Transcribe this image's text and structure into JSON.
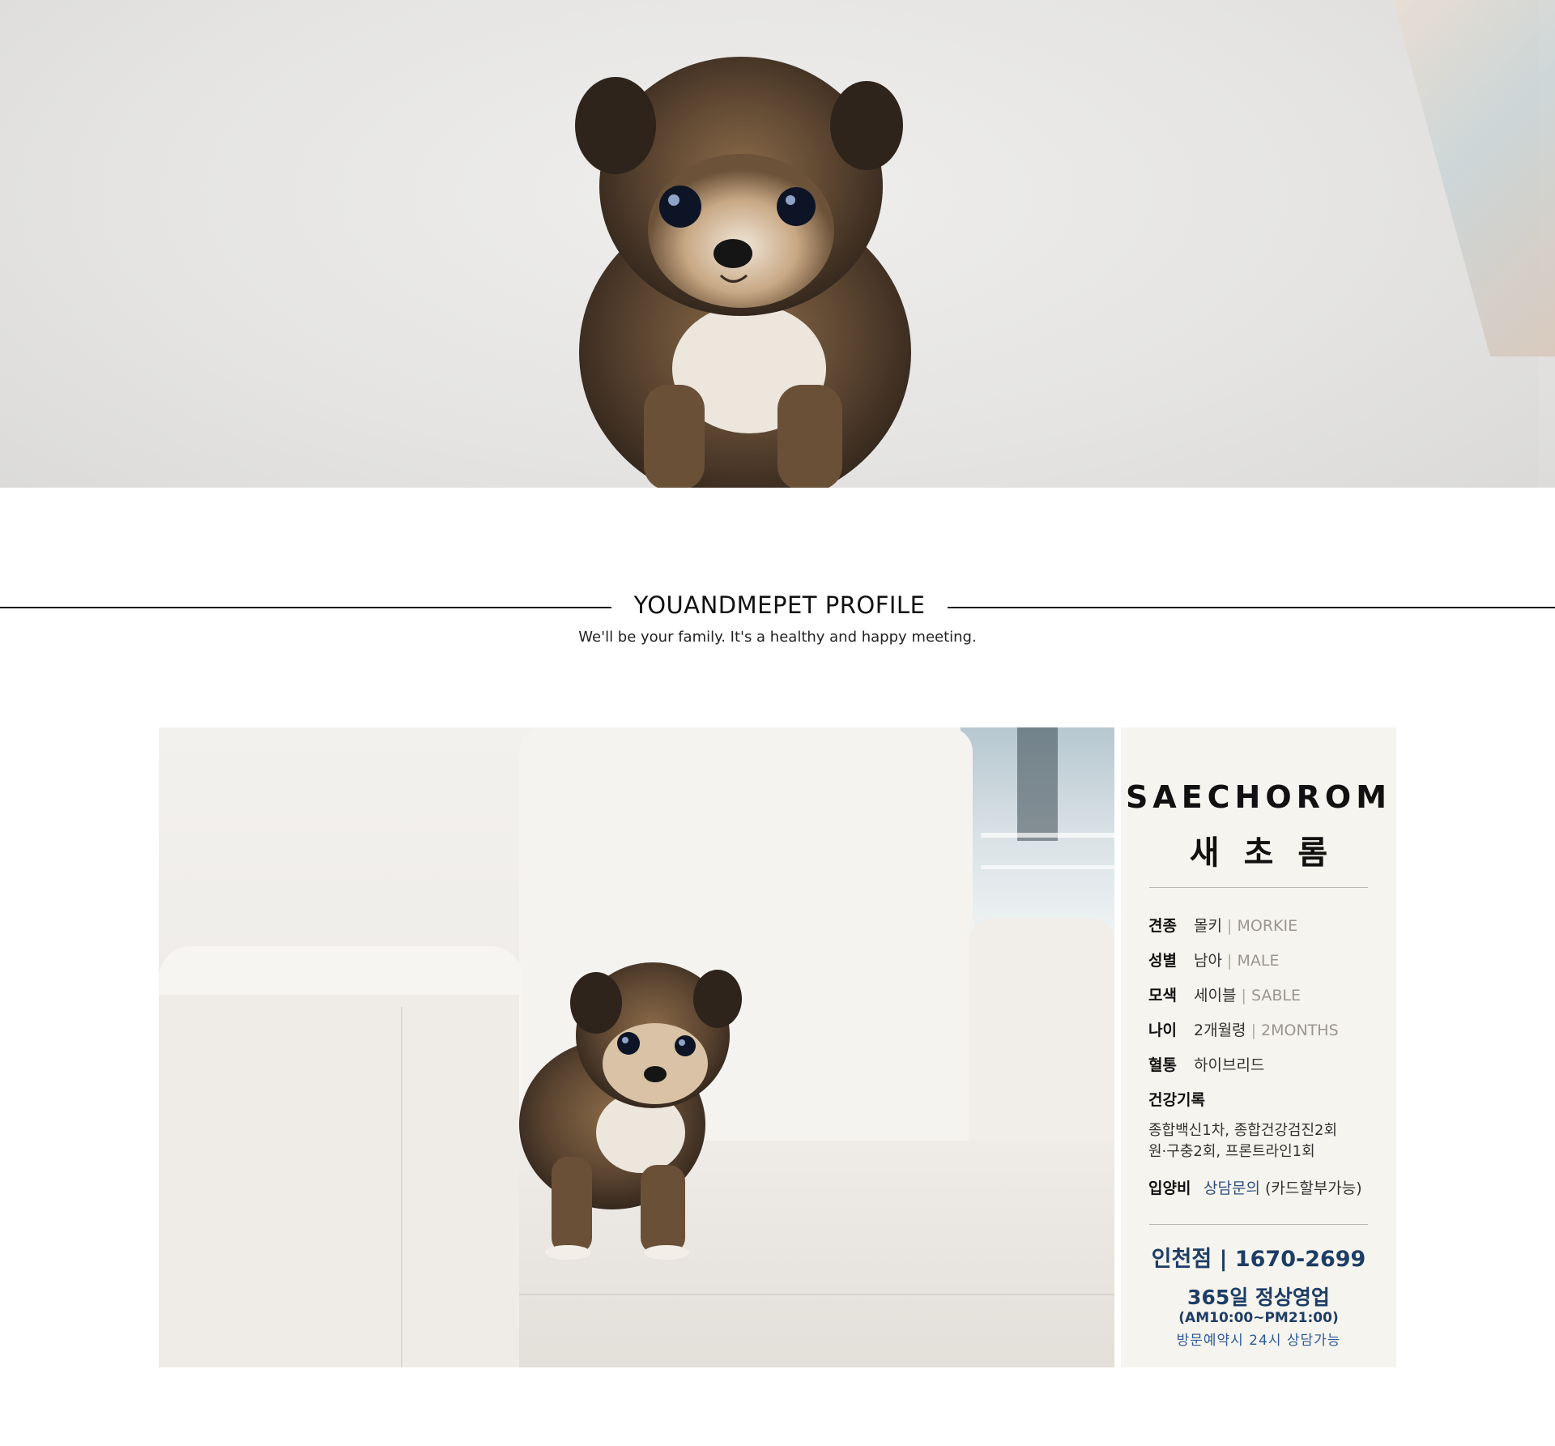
{
  "heading": {
    "title": "YOUANDMEPET PROFILE",
    "subtitle": "We'll be your family. It's a healthy and happy meeting."
  },
  "profile": {
    "name_en": "SAECHOROM",
    "name_ko": "새초롬",
    "breed": {
      "label": "견종",
      "value": "몰키",
      "value_en": "MORKIE"
    },
    "gender": {
      "label": "성별",
      "value": "남아",
      "value_en": "MALE"
    },
    "color": {
      "label": "모색",
      "value": "세이블",
      "value_en": "SABLE"
    },
    "age": {
      "label": "나이",
      "value": "2개월령",
      "value_en": "2MONTHS"
    },
    "bloodline": {
      "label": "혈통",
      "value": "하이브리드"
    },
    "health": {
      "label": "건강기록",
      "line1": "종합백신1차, 종합건강검진2회",
      "line2": "원·구충2회, 프론트라인1회"
    },
    "price": {
      "label": "입양비",
      "link": "상담문의",
      "note": "(카드할부가능)"
    }
  },
  "contact": {
    "branch": "인천점 | 1670-2699",
    "open": "365일 정상영업",
    "hours": "(AM10:00~PM21:00)",
    "visit": "방문예약시 24시 상담가능"
  },
  "separator": "|",
  "images": {
    "hero": "puppy-sitting-on-cushion-photo",
    "profile": "puppy-standing-on-sofa-photo"
  }
}
